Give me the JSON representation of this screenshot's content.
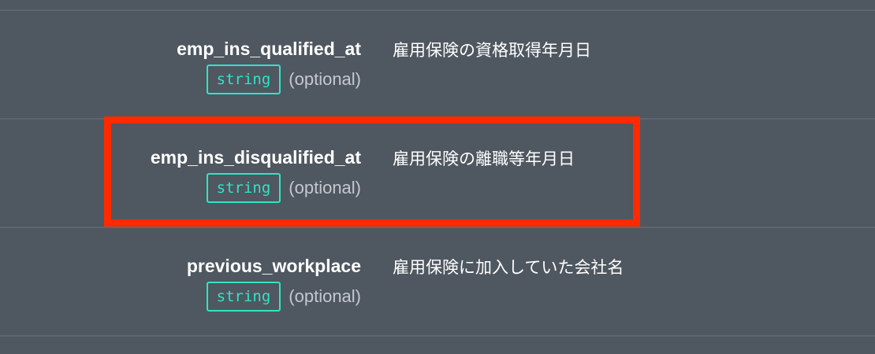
{
  "colors": {
    "background": "#4f5760",
    "divider": "#5c6670",
    "badge": "#2ee5c6",
    "highlight": "#ff2a00"
  },
  "params": [
    {
      "name": "emp_ins_qualified_at",
      "type": "string",
      "optional": "(optional)",
      "description": "雇用保険の資格取得年月日"
    },
    {
      "name": "emp_ins_disqualified_at",
      "type": "string",
      "optional": "(optional)",
      "description": "雇用保険の離職等年月日"
    },
    {
      "name": "previous_workplace",
      "type": "string",
      "optional": "(optional)",
      "description": "雇用保険に加入していた会社名"
    }
  ]
}
